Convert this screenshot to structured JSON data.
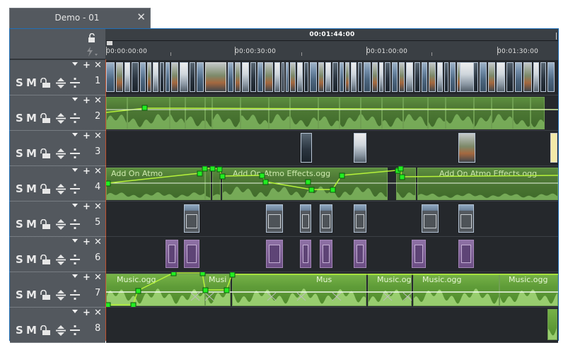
{
  "tab": {
    "title": "Demo - 01",
    "close": "✕"
  },
  "ruler": {
    "position": "00:01:44:00",
    "ticks": [
      "00:00:00:00",
      "00:00:30:00",
      "00:01:00:00",
      "00:01:30:00"
    ]
  },
  "header": {
    "lock_icon": "padlock-open-icon",
    "snap_icon": "lightning-icon"
  },
  "track_controls": {
    "solo": "S",
    "mute": "M",
    "dropdown": "▾",
    "add": "+",
    "delete": "✕"
  },
  "tracks": [
    {
      "number": "1",
      "type": "video"
    },
    {
      "number": "2",
      "type": "audio"
    },
    {
      "number": "3",
      "type": "video"
    },
    {
      "number": "4",
      "type": "audio",
      "clip_labels": [
        "Add On Atmo",
        "Add On Atmo Effects.ogg",
        "Add On Atmo Effects.ogg"
      ]
    },
    {
      "number": "5",
      "type": "effect"
    },
    {
      "number": "6",
      "type": "effect"
    },
    {
      "number": "7",
      "type": "audio",
      "clip_labels": [
        "Music.ogg",
        "Musi",
        "Mus",
        "Music.ogg",
        "Music.ogg",
        "Music.ogg"
      ]
    },
    {
      "number": "8",
      "type": "audio"
    }
  ],
  "colors": {
    "accent": "#1f6fb8",
    "audio_clip": "#4f7a36",
    "keyframe": "#22ee22",
    "envelope": "#b6f23a",
    "effect_purple": "#7a5b95"
  }
}
